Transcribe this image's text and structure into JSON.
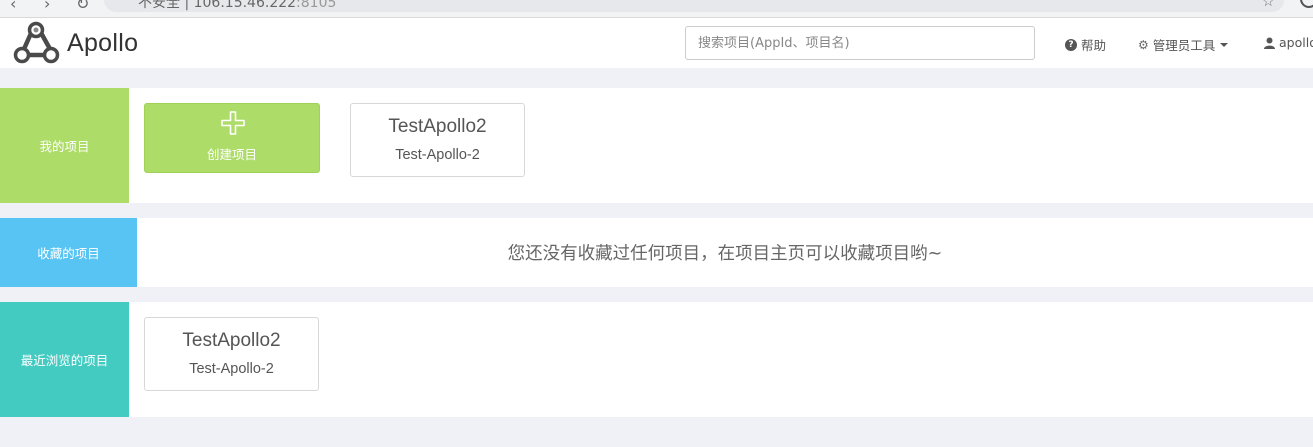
{
  "browser": {
    "url_prefix": "不安全 | 106.15.46.222",
    "url_suffix": ":8105"
  },
  "header": {
    "logo_text": "Apollo",
    "search_placeholder": "搜索项目(AppId、项目名)",
    "help_label": "帮助",
    "admin_label": "管理员工具",
    "user_label": "apollo"
  },
  "sections": {
    "mine": {
      "title": "我的项目",
      "create_label": "创建项目",
      "apps": [
        {
          "name": "TestApollo2",
          "appid": "Test-Apollo-2"
        }
      ]
    },
    "favorites": {
      "title": "收藏的项目",
      "empty_text": "您还没有收藏过任何项目，在项目主页可以收藏项目哟~"
    },
    "recent": {
      "title": "最近浏览的项目",
      "apps": [
        {
          "name": "TestApollo2",
          "appid": "Test-Apollo-2"
        }
      ]
    }
  },
  "colors": {
    "mine": "#addc69",
    "favorites": "#57c4f4",
    "recent": "#43cbc2",
    "page_bg": "#eff1f6"
  },
  "icons": {
    "help": "question-circle-icon",
    "admin": "gear-icon",
    "user": "user-icon",
    "create": "plus-icon",
    "logo": "apollo-logo-icon"
  }
}
